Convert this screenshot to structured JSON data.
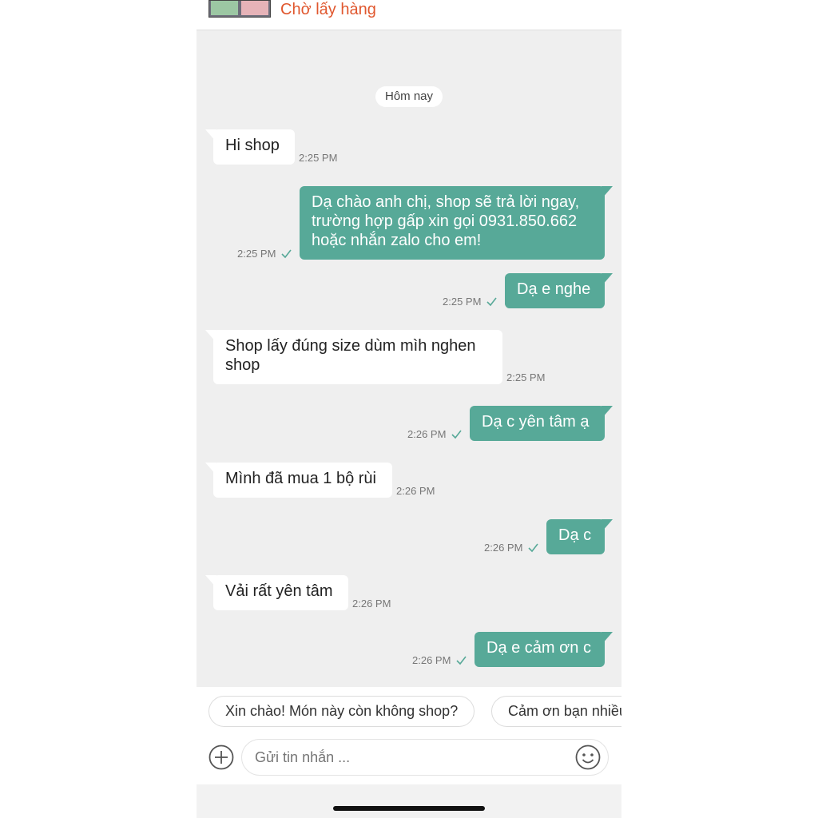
{
  "order": {
    "status": "Chờ lấy hàng",
    "thumbnail_icon": "product-thumbnail"
  },
  "date_separator": "Hôm nay",
  "messages": [
    {
      "side": "in",
      "text": "Hi shop",
      "time": "2:25 PM"
    },
    {
      "side": "out",
      "text": "Dạ chào anh chị, shop sẽ trả lời ngay,\ntrường hợp gấp xin gọi 0931.850.662\nhoặc nhắn zalo cho em!",
      "time": "2:25 PM"
    },
    {
      "side": "out",
      "text": "Dạ e nghe",
      "time": "2:25 PM"
    },
    {
      "side": "in",
      "text": "Shop lấy đúng size dùm mìh nghen\nshop",
      "time": "2:25 PM"
    },
    {
      "side": "out",
      "text": "Dạ c yên tâm ạ",
      "time": "2:26 PM"
    },
    {
      "side": "in",
      "text": "Mình đã mua 1 bộ rùi",
      "time": "2:26 PM"
    },
    {
      "side": "out",
      "text": "Dạ c",
      "time": "2:26 PM"
    },
    {
      "side": "in",
      "text": "Vải rất yên tâm",
      "time": "2:26 PM"
    },
    {
      "side": "out",
      "text": "Dạ e cảm ơn c",
      "time": "2:26 PM"
    }
  ],
  "quick_replies": [
    "Xin chào! Món này còn không shop?",
    "Cảm ơn bạn nhiều"
  ],
  "composer": {
    "placeholder": "Gửi tin nhắn ...",
    "attach_icon": "plus-circle-icon",
    "emoji_icon": "emoji-icon"
  },
  "colors": {
    "outgoing_bubble": "#57a998",
    "incoming_bubble": "#ffffff",
    "status_accent": "#e0572e",
    "background": "#efefef"
  }
}
